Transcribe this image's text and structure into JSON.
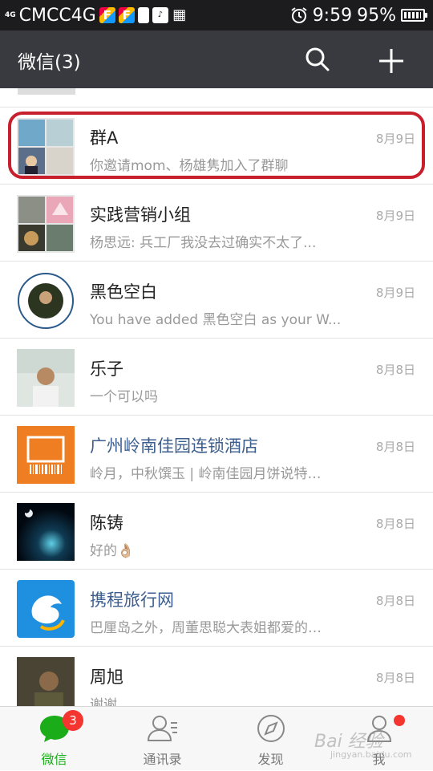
{
  "status": {
    "signal": "4G",
    "carrier": "CMCC4G",
    "time": "9:59",
    "battery": "95%",
    "battery_level": 0.95
  },
  "header": {
    "title": "微信(3)"
  },
  "chats": [
    {
      "name": "群A",
      "preview": "你邀请mom、杨雄隽加入了群聊",
      "date": "8月9日",
      "official": false
    },
    {
      "name": "实践营销小组",
      "preview": "杨思远: 兵工厂我没去过确实不太了...",
      "date": "8月9日",
      "official": false
    },
    {
      "name": "黑色空白",
      "preview": "You have added 黑色空白 as your W...",
      "date": "8月9日",
      "official": false
    },
    {
      "name": "乐子",
      "preview": "一个可以吗",
      "date": "8月8日",
      "official": false
    },
    {
      "name": "广州岭南佳园连锁酒店",
      "preview": "岭月，中秋馔玉 | 岭南佳园月饼说特…",
      "date": "8月8日",
      "official": true
    },
    {
      "name": "陈铸",
      "preview": "好的👌🏼",
      "date": "8月8日",
      "official": false
    },
    {
      "name": "携程旅行网",
      "preview": "巴厘岛之外，周董思聪大表姐都爱的…",
      "date": "8月8日",
      "official": true
    },
    {
      "name": "周旭",
      "preview": "谢谢",
      "date": "8月8日",
      "official": false
    }
  ],
  "tabs": [
    {
      "label": "微信",
      "badge": "3",
      "icon": "chat-bubble-icon",
      "active": true
    },
    {
      "label": "通讯录",
      "icon": "contacts-icon"
    },
    {
      "label": "发现",
      "icon": "compass-icon"
    },
    {
      "label": "我",
      "icon": "person-icon",
      "dot": true
    }
  ],
  "watermark": {
    "text": "Bai 经验",
    "sub": "jingyan.baidu.com"
  },
  "colors": {
    "accent": "#1aad19",
    "header_bg": "#393a3f",
    "badge": "#f43530",
    "highlight": "#c81f2d",
    "official": "#3b5e8f"
  }
}
